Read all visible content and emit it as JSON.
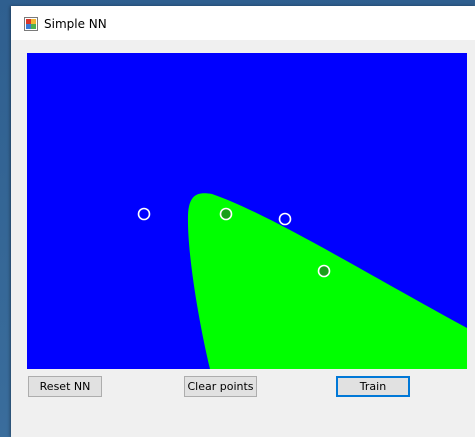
{
  "window": {
    "title": "Simple NN",
    "icon": "windows-forms-app-icon"
  },
  "canvas": {
    "background_color": "#0000ff",
    "region_color": "#00ff00",
    "point_classes": [
      {
        "class": "blue",
        "fill": "#0000ff",
        "stroke": "#ffffff",
        "count": 2
      },
      {
        "class": "green",
        "fill": "#1a9e1a",
        "stroke": "#ffffff",
        "count": 2
      }
    ]
  },
  "buttons": {
    "reset_label": "Reset NN",
    "clear_label": "Clear points",
    "train_label": "Train"
  },
  "colors": {
    "window_bg": "#f0f0f0",
    "button_bg": "#e1e1e1",
    "focus_border": "#0078d7"
  }
}
